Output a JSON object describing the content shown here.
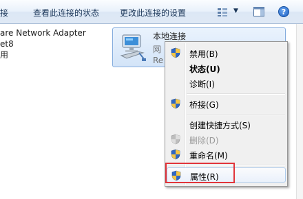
{
  "toolbar": {
    "item1": "连接",
    "item2": "查看此连接的状态",
    "item3": "更改此连接的设置",
    "views_icon": "views-grid-icon",
    "pane_icon": "preview-pane-icon",
    "help_label": "?"
  },
  "left_item": {
    "line1": "are Network Adapter",
    "line2": "et8",
    "line3": "用"
  },
  "selected_item": {
    "name": "本地连接",
    "sub1": "网",
    "sub2": "Re"
  },
  "context_menu": {
    "items": [
      {
        "label": "禁用(B)",
        "icon": "shield-icon",
        "style": "normal"
      },
      {
        "label": "状态(U)",
        "icon": "",
        "style": "bold"
      },
      {
        "label": "诊断(I)",
        "icon": "",
        "style": "normal"
      },
      {
        "label": "桥接(G)",
        "icon": "shield-icon",
        "style": "normal"
      },
      {
        "label": "创建快捷方式(S)",
        "icon": "",
        "style": "normal"
      },
      {
        "label": "删除(D)",
        "icon": "shield-icon-disabled",
        "style": "disabled"
      },
      {
        "label": "重命名(M)",
        "icon": "shield-icon",
        "style": "normal"
      },
      {
        "label": "属性(R)",
        "icon": "shield-icon",
        "style": "hover"
      }
    ]
  },
  "colors": {
    "highlight_border": "#e1343a",
    "hover_border": "#aeccec"
  }
}
